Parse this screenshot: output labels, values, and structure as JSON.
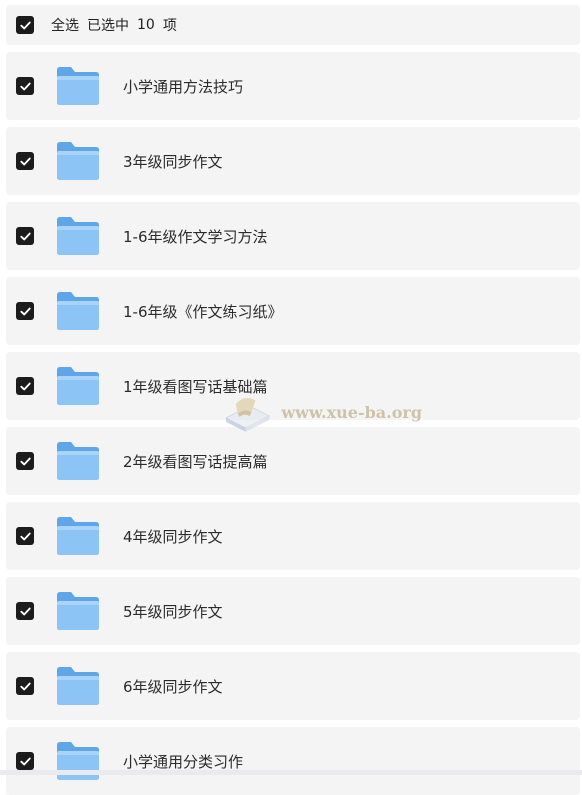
{
  "header": {
    "select_all": "全选",
    "selected_prefix": "已选中",
    "selected_count": "10",
    "selected_suffix": "项"
  },
  "folders": [
    {
      "name": "小学通用方法技巧",
      "checked": true
    },
    {
      "name": "3年级同步作文",
      "checked": true
    },
    {
      "name": "1-6年级作文学习方法",
      "checked": true
    },
    {
      "name": "1-6年级《作文练习纸》",
      "checked": true
    },
    {
      "name": "1年级看图写话基础篇",
      "checked": true
    },
    {
      "name": "2年级看图写话提高篇",
      "checked": true
    },
    {
      "name": "4年级同步作文",
      "checked": true
    },
    {
      "name": "5年级同步作文",
      "checked": true
    },
    {
      "name": "6年级同步作文",
      "checked": true
    },
    {
      "name": "小学通用分类习作",
      "checked": true
    }
  ],
  "watermark": {
    "text": "www.xue-ba.org",
    "icon": "book-logo-icon"
  },
  "colors": {
    "row_bg": "#f4f4f5",
    "checkbox": "#1c1c1c",
    "folder_front": "#8cc4f5",
    "folder_back": "#5fa6e8"
  }
}
